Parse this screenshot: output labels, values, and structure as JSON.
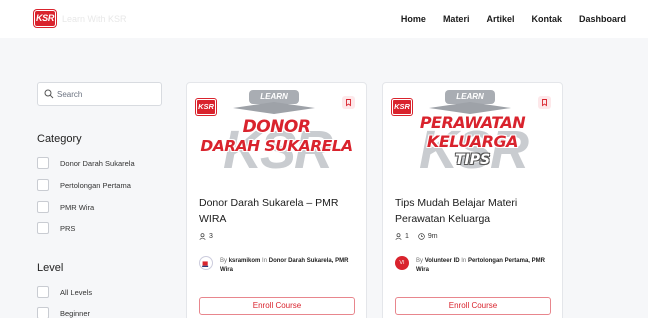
{
  "header": {
    "logo_text": "KSR",
    "site_name": "Learn With KSR",
    "nav": [
      {
        "label": "Home"
      },
      {
        "label": "Materi"
      },
      {
        "label": "Artikel"
      },
      {
        "label": "Kontak"
      },
      {
        "label": "Dashboard"
      }
    ]
  },
  "sidebar": {
    "search": {
      "placeholder": "Search",
      "value": ""
    },
    "category": {
      "heading": "Category",
      "items": [
        {
          "label": "Donor Darah Sukarela",
          "checked": false
        },
        {
          "label": "Pertolongan Pertama",
          "checked": false
        },
        {
          "label": "PMR Wira",
          "checked": false
        },
        {
          "label": "PRS",
          "checked": false
        }
      ]
    },
    "level": {
      "heading": "Level",
      "items": [
        {
          "label": "All Levels",
          "checked": false
        },
        {
          "label": "Beginner",
          "checked": false
        }
      ]
    }
  },
  "courses": [
    {
      "badge": "KSR",
      "learn_banner": "LEARN",
      "thumb_lines": [
        "DONOR",
        "DARAH SUKARELA"
      ],
      "thumb_watermark": "KSR",
      "title": "Donor Darah Sukarela – PMR WIRA",
      "students": "3",
      "duration": "",
      "author_by": "By",
      "author": "ksramikom",
      "author_in": "In",
      "categories": "Donor Darah Sukarela, PMR Wira",
      "avatar_text": "",
      "enroll_label": "Enroll Course"
    },
    {
      "badge": "KSR",
      "learn_banner": "LEARN",
      "thumb_lines": [
        "PERAWATAN",
        "KELUARGA",
        "TIPS"
      ],
      "thumb_watermark": "KSR",
      "title": "Tips Mudah Belajar Materi Perawatan Keluarga",
      "students": "1",
      "duration": "9m",
      "author_by": "By",
      "author": "Volunteer ID",
      "author_in": "In",
      "categories": "Pertolongan Pertama, PMR Wira",
      "avatar_text": "VI",
      "enroll_label": "Enroll Course"
    }
  ],
  "colors": {
    "brand_red": "#d9232d",
    "bookmark_bg": "#fde8ea",
    "content_bg": "#f6f7f9"
  },
  "icons": {
    "search": "search-icon",
    "bookmark": "bookmark-icon",
    "students": "user-icon",
    "duration": "clock-icon"
  }
}
